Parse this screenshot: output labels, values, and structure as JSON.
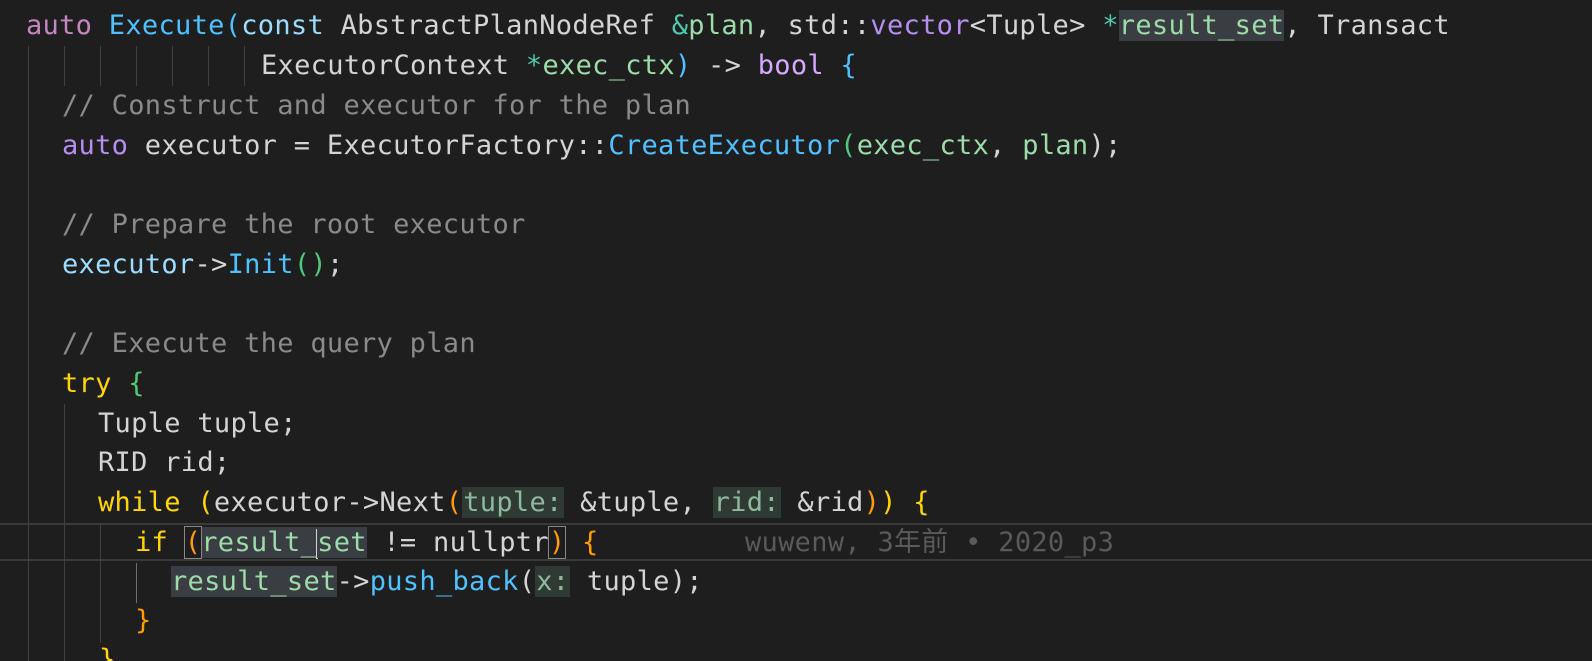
{
  "editor": {
    "lines": [
      {
        "id": "l1",
        "text_parts": [
          "auto",
          " ",
          "Execute",
          "(",
          "const",
          " AbstractPlanNodeRef ",
          "&",
          "plan",
          ", ",
          "std",
          "::",
          "vector",
          "<Tuple> ",
          "*",
          "result_set",
          ", ",
          "Transact"
        ]
      },
      {
        "id": "l2",
        "text_parts": [
          "ExecutorContext ",
          "*",
          "exec_ctx",
          ")",
          " -> ",
          "bool",
          " ",
          "{"
        ]
      },
      {
        "id": "l3",
        "comment": "// Construct and executor for the plan"
      },
      {
        "id": "l4",
        "text_parts": [
          "auto",
          " executor = ExecutorFactory::",
          "CreateExecutor",
          "(",
          "exec_ctx",
          ", ",
          "plan",
          ");"
        ]
      },
      {
        "id": "l6",
        "comment": "// Prepare the root executor"
      },
      {
        "id": "l7",
        "text_parts": [
          "executor",
          "->",
          "Init",
          "(",
          ")",
          ";"
        ]
      },
      {
        "id": "l9",
        "comment": "// Execute the query plan"
      },
      {
        "id": "l10",
        "text_parts": [
          "try",
          " ",
          "{"
        ]
      },
      {
        "id": "l11",
        "text_parts": [
          "Tuple tuple;"
        ]
      },
      {
        "id": "l12",
        "text_parts": [
          "RID rid;"
        ]
      },
      {
        "id": "l13",
        "text_parts": [
          "while",
          " ",
          "(",
          "executor->Next",
          "(",
          "tuple:",
          " &tuple, ",
          "rid:",
          " &rid",
          ")",
          ")",
          " ",
          "{"
        ]
      },
      {
        "id": "l14",
        "text_parts": [
          "if",
          " ",
          "(",
          "result_",
          "set",
          " != nullptr",
          ")",
          " ",
          "{"
        ],
        "blame": "wuwenw, 3年前 • 2020_p3"
      },
      {
        "id": "l15",
        "text_parts": [
          "result_set",
          "->",
          "push_back",
          "(",
          "x:",
          " tuple",
          ")",
          ";"
        ]
      },
      {
        "id": "l16",
        "text_parts": [
          "}"
        ]
      }
    ]
  }
}
